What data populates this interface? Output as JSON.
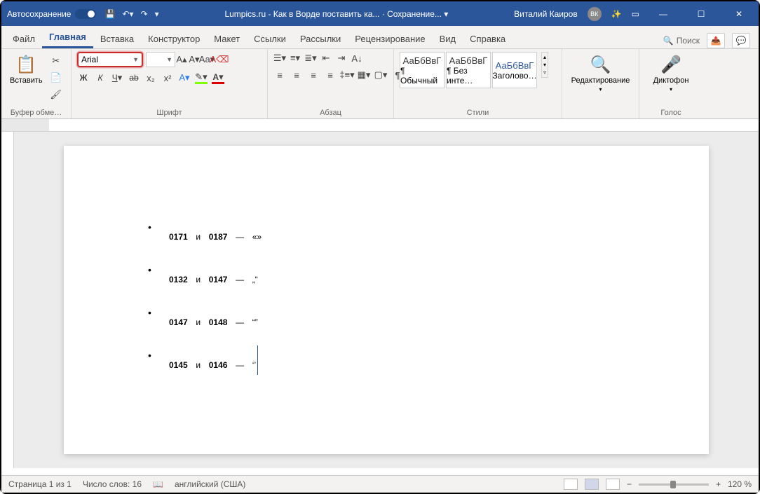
{
  "titlebar": {
    "autosave": "Автосохранение",
    "doc_title": "Lumpics.ru - Как в Ворде поставить ка... ·",
    "save_status": "Сохранение... ▾",
    "user_name": "Виталий Каиров",
    "user_initials": "ВК"
  },
  "tabs": {
    "file": "Файл",
    "home": "Главная",
    "insert": "Вставка",
    "design": "Конструктор",
    "layout": "Макет",
    "references": "Ссылки",
    "mailings": "Рассылки",
    "review": "Рецензирование",
    "view": "Вид",
    "help": "Справка",
    "search": "Поиск"
  },
  "ribbon": {
    "paste": "Вставить",
    "clipboard": "Буфер обме…",
    "font": {
      "name": "Arial",
      "size": ""
    },
    "font_group": "Шрифт",
    "para_group": "Абзац",
    "styles_group": "Стили",
    "edit": "Редактирование",
    "voice": "Диктофон",
    "voice_group": "Голос",
    "styles": {
      "normal_prev": "АаБбВвГ",
      "normal": "¶ Обычный",
      "nospace_prev": "АаБбВвГ",
      "nospace": "¶ Без инте…",
      "heading_prev": "АаБбВвГ",
      "heading": "Заголово…"
    }
  },
  "document": {
    "lines": [
      {
        "a": "0171",
        "b": "0187",
        "q": "«»"
      },
      {
        "a": "0132",
        "b": "0147",
        "q": "„“"
      },
      {
        "a": "0147",
        "b": "0148",
        "q": "“”"
      },
      {
        "a": "0145",
        "b": "0146",
        "q": "‘’"
      }
    ],
    "sep": "и",
    "dash": "—"
  },
  "status": {
    "page": "Страница 1 из 1",
    "words": "Число слов: 16",
    "lang": "английский (США)",
    "zoom": "120 %"
  }
}
